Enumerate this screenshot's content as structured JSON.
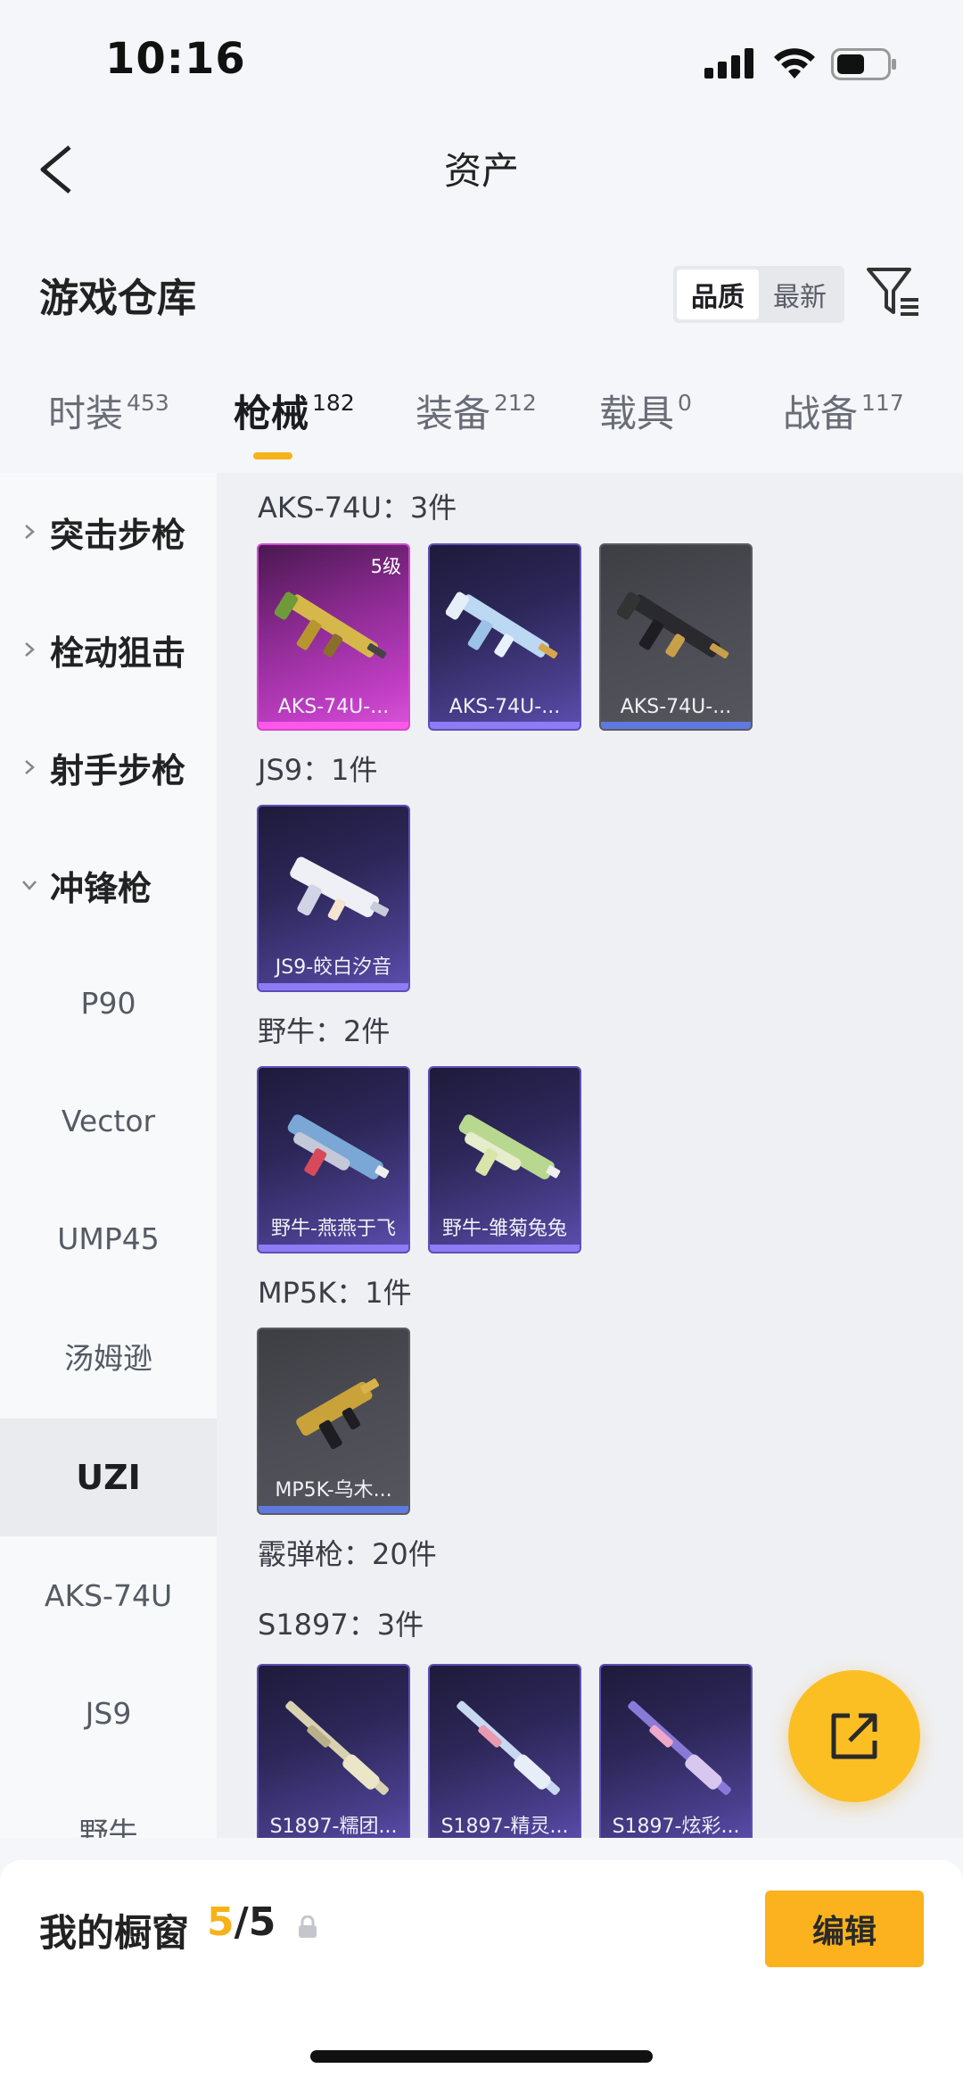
{
  "status_bar": {
    "time": "10:16"
  },
  "nav": {
    "title": "资产"
  },
  "warehouse": {
    "title": "游戏仓库",
    "sort": {
      "options": [
        "品质",
        "最新"
      ],
      "selected": "品质"
    }
  },
  "tabs": [
    {
      "label": "时装",
      "count": "453"
    },
    {
      "label": "枪械",
      "count": "182",
      "active": true
    },
    {
      "label": "装备",
      "count": "212"
    },
    {
      "label": "载具",
      "count": "0"
    },
    {
      "label": "战备",
      "count": "117"
    }
  ],
  "sidebar": {
    "categories": [
      {
        "label": "突击步枪",
        "expanded": false
      },
      {
        "label": "栓动狙击",
        "expanded": false
      },
      {
        "label": "射手步枪",
        "expanded": false
      },
      {
        "label": "冲锋枪",
        "expanded": true
      }
    ],
    "subitems": [
      "P90",
      "Vector",
      "UMP45",
      "汤姆逊",
      "UZI",
      "AKS-74U",
      "JS9",
      "野牛"
    ],
    "selected": "UZI"
  },
  "groups": [
    {
      "title": "AKS-74U：3件",
      "items": [
        {
          "name": "AKS-74U-...",
          "rarity": "pink",
          "level": "5级"
        },
        {
          "name": "AKS-74U-...",
          "rarity": "purple"
        },
        {
          "name": "AKS-74U-...",
          "rarity": "grey"
        }
      ]
    },
    {
      "title": "JS9：1件",
      "items": [
        {
          "name": "JS9-皎白汐音",
          "rarity": "purple"
        }
      ]
    },
    {
      "title": "野牛：2件",
      "items": [
        {
          "name": "野牛-燕燕于飞",
          "rarity": "purple"
        },
        {
          "name": "野牛-雏菊兔兔",
          "rarity": "purple"
        }
      ]
    },
    {
      "title": "MP5K：1件",
      "items": [
        {
          "name": "MP5K-乌木...",
          "rarity": "grey"
        }
      ]
    },
    {
      "title": "霰弹枪：20件",
      "items": []
    },
    {
      "title": "S1897：3件",
      "items": [
        {
          "name": "S1897-糯团...",
          "rarity": "purple"
        },
        {
          "name": "S1897-精灵...",
          "rarity": "purple"
        },
        {
          "name": "S1897-炫彩...",
          "rarity": "purple"
        }
      ]
    }
  ],
  "showcase": {
    "label": "我的橱窗",
    "current": "5",
    "total": "/5"
  },
  "edit_button": {
    "label": "编辑"
  },
  "colors": {
    "accent": "#fbb21e",
    "purple": "#5c4fb0",
    "pink": "#d449d0",
    "grey": "#56575e"
  }
}
